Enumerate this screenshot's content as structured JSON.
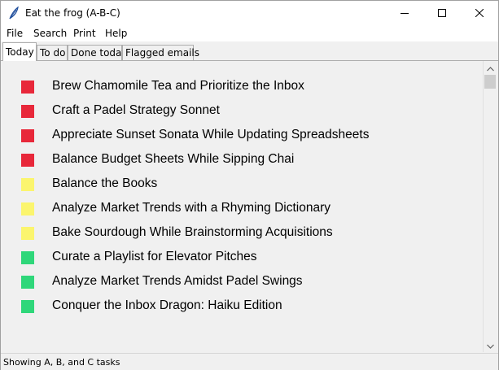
{
  "window": {
    "title": "Eat the frog (A-B-C)"
  },
  "menu": [
    "File",
    "Search",
    "Print",
    "Help"
  ],
  "tabs": [
    "Today",
    "To do",
    "Done today",
    "Flagged emails"
  ],
  "tasks": [
    {
      "label": "Brew Chamomile Tea and Prioritize the Inbox",
      "priority": "A",
      "color": "#e8283a"
    },
    {
      "label": "Craft a Padel Strategy Sonnet",
      "priority": "A",
      "color": "#e8283a"
    },
    {
      "label": "Appreciate Sunset Sonata While Updating Spreadsheets",
      "priority": "A",
      "color": "#e8283a"
    },
    {
      "label": "Balance Budget Sheets While Sipping Chai",
      "priority": "A",
      "color": "#e8283a"
    },
    {
      "label": "Balance the Books",
      "priority": "B",
      "color": "#fbf56e"
    },
    {
      "label": "Analyze Market Trends with a Rhyming Dictionary",
      "priority": "B",
      "color": "#fbf56e"
    },
    {
      "label": "Bake Sourdough While Brainstorming Acquisitions",
      "priority": "B",
      "color": "#fbf56e"
    },
    {
      "label": "Curate a Playlist for Elevator Pitches",
      "priority": "C",
      "color": "#2fd77a"
    },
    {
      "label": "Analyze Market Trends Amidst Padel Swings",
      "priority": "C",
      "color": "#2fd77a"
    },
    {
      "label": "Conquer the Inbox Dragon: Haiku Edition",
      "priority": "C",
      "color": "#2fd77a"
    }
  ],
  "status": "Showing A, B, and C tasks",
  "icons": {
    "app": "feather-icon",
    "minimize": "minimize-icon",
    "maximize": "maximize-icon",
    "close": "close-icon",
    "scroll_up": "chevron-up-icon",
    "scroll_down": "chevron-down-icon"
  }
}
